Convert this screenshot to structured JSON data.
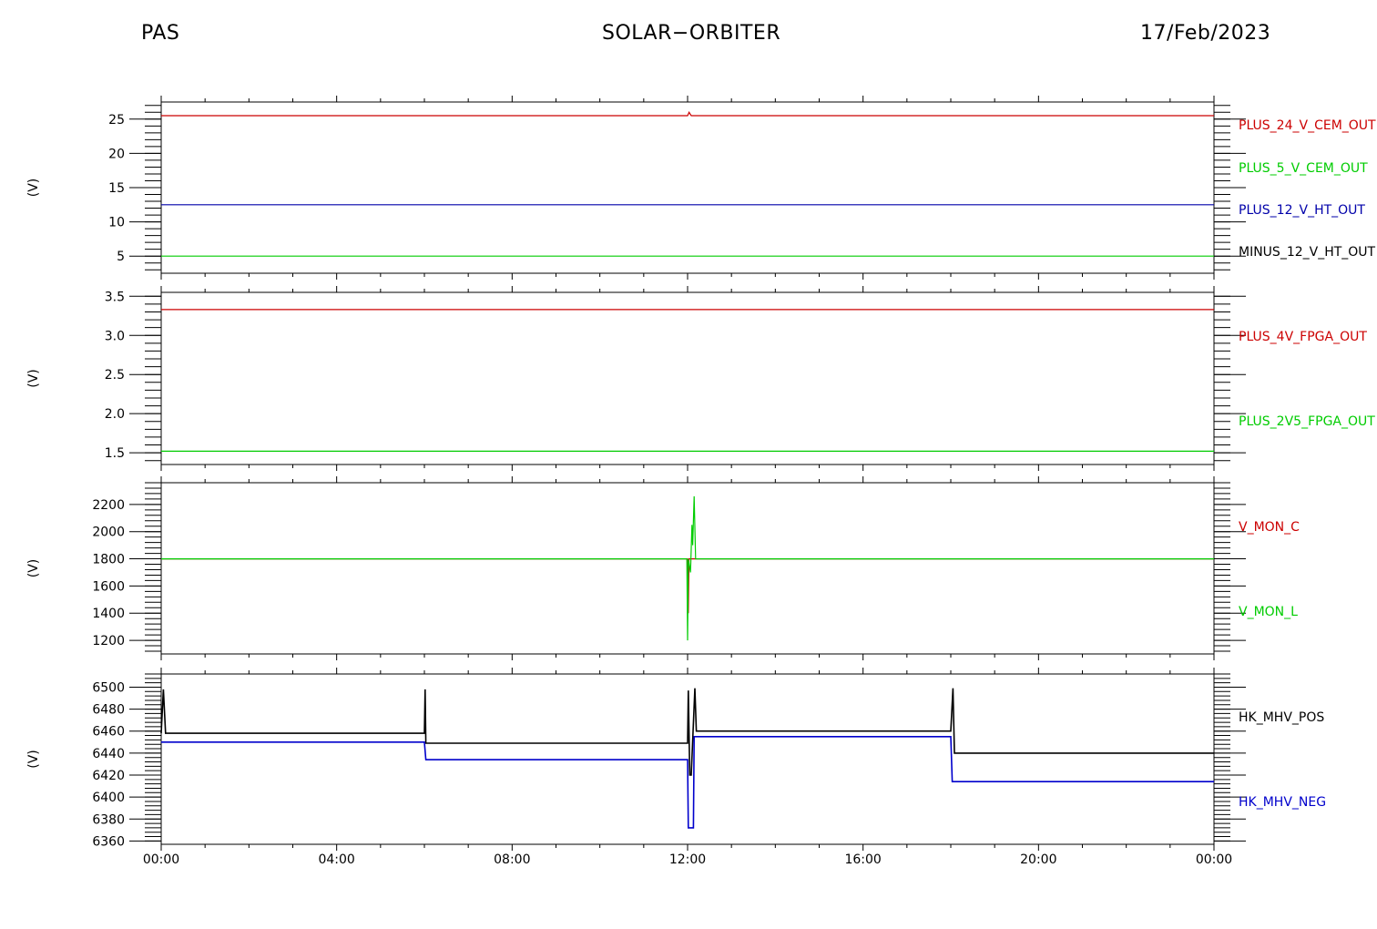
{
  "header": {
    "left": "PAS",
    "center": "SOLAR−ORBITER",
    "right": "17/Feb/2023"
  },
  "chart_data": [
    {
      "type": "line",
      "ylabel": "(V)",
      "ylim": [
        2.5,
        27.5
      ],
      "yticks": [
        5,
        10,
        15,
        20,
        25
      ],
      "xlim": [
        "00:00",
        "24:00"
      ],
      "series": [
        {
          "name": "PLUS_24_V_CEM_OUT",
          "color": "#cc0000",
          "x": [
            "00:00",
            "12:00",
            "12:02",
            "12:05",
            "24:00"
          ],
          "y": [
            25.5,
            25.5,
            26.0,
            25.5,
            25.5
          ]
        },
        {
          "name": "PLUS_5_V_CEM_OUT",
          "color": "#00cc00",
          "x": [
            "00:00",
            "24:00"
          ],
          "y": [
            5.0,
            5.0
          ]
        },
        {
          "name": "PLUS_12_V_HT_OUT",
          "color": "#0000aa",
          "x": [
            "00:00",
            "24:00"
          ],
          "y": [
            12.5,
            12.5
          ]
        },
        {
          "name": "MINUS_12_V_HT_OUT",
          "color": "#000000",
          "x": [],
          "y": []
        }
      ]
    },
    {
      "type": "line",
      "ylabel": "(V)",
      "ylim": [
        1.35,
        3.55
      ],
      "yticks": [
        1.5,
        2.0,
        2.5,
        3.0,
        3.5
      ],
      "ytick_labels": [
        "1.5",
        "2.0",
        "2.5",
        "3.0",
        "3.5"
      ],
      "xlim": [
        "00:00",
        "24:00"
      ],
      "series": [
        {
          "name": "PLUS_4V_FPGA_OUT",
          "color": "#cc0000",
          "x": [
            "00:00",
            "24:00"
          ],
          "y": [
            3.33,
            3.33
          ]
        },
        {
          "name": "PLUS_2V5_FPGA_OUT",
          "color": "#00cc00",
          "x": [
            "00:00",
            "24:00"
          ],
          "y": [
            1.52,
            1.52
          ]
        }
      ]
    },
    {
      "type": "line",
      "ylabel": "(V)",
      "ylim": [
        1100,
        2360
      ],
      "yticks": [
        1200,
        1400,
        1600,
        1800,
        2000,
        2200
      ],
      "xlim": [
        "00:00",
        "24:00"
      ],
      "series": [
        {
          "name": "V_MON_C",
          "color": "#cc0000",
          "x": [
            "00:00",
            "12:00",
            "12:01",
            "12:02",
            "12:04",
            "24:00"
          ],
          "y": [
            1800,
            1800,
            1400,
            1800,
            1800,
            1800
          ]
        },
        {
          "name": "V_MON_L",
          "color": "#00cc00",
          "x": [
            "00:00",
            "11:59",
            "12:00",
            "12:01",
            "12:04",
            "12:06",
            "12:07",
            "12:09",
            "12:11",
            "24:00"
          ],
          "y": [
            1800,
            1800,
            1200,
            1800,
            1700,
            2050,
            1900,
            2260,
            1800,
            1800
          ]
        }
      ]
    },
    {
      "type": "line",
      "ylabel": "(V)",
      "ylim": [
        6357,
        6512
      ],
      "yticks": [
        6360,
        6380,
        6400,
        6420,
        6440,
        6460,
        6480,
        6500
      ],
      "xlim": [
        "00:00",
        "24:00"
      ],
      "series": [
        {
          "name": "HK_MHV_POS",
          "color": "#000000",
          "x": [
            "00:00",
            "00:03",
            "00:06",
            "06:00",
            "06:01",
            "06:02",
            "12:00",
            "12:01",
            "12:03",
            "12:05",
            "12:10",
            "12:12",
            "18:00",
            "18:03",
            "18:05",
            "24:00"
          ],
          "y": [
            6458,
            6498,
            6458,
            6458,
            6498,
            6449,
            6449,
            6497,
            6420,
            6420,
            6499,
            6460,
            6460,
            6499,
            6440,
            6440
          ]
        },
        {
          "name": "HK_MHV_NEG",
          "color": "#0000cc",
          "x": [
            "00:00",
            "06:00",
            "06:02",
            "12:00",
            "12:01",
            "12:08",
            "12:09",
            "12:10",
            "18:00",
            "18:02",
            "24:00"
          ],
          "y": [
            6450,
            6450,
            6434,
            6434,
            6372,
            6372,
            6455,
            6455,
            6455,
            6414,
            6414
          ]
        }
      ]
    }
  ],
  "x_axis": {
    "tick_labels": [
      "00:00",
      "04:00",
      "08:00",
      "12:00",
      "16:00",
      "20:00",
      "00:00"
    ]
  }
}
